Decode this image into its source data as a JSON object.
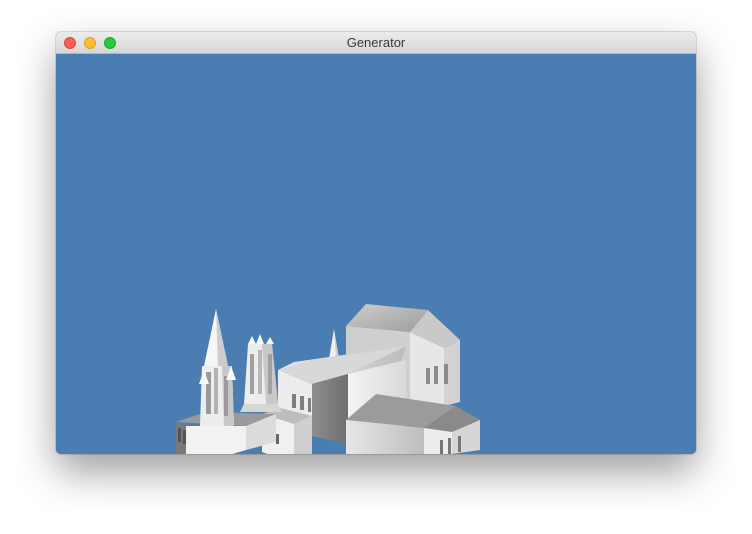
{
  "window": {
    "title": "Generator",
    "controls": {
      "close": "close-button",
      "minimize": "minimize-button",
      "zoom": "zoom-button"
    }
  },
  "viewport": {
    "background_color": "#4a7eb2",
    "scene": "3d-cathedral-model"
  },
  "colors": {
    "close": "#fe5f57",
    "minimize": "#febc2e",
    "zoom": "#28c840"
  }
}
